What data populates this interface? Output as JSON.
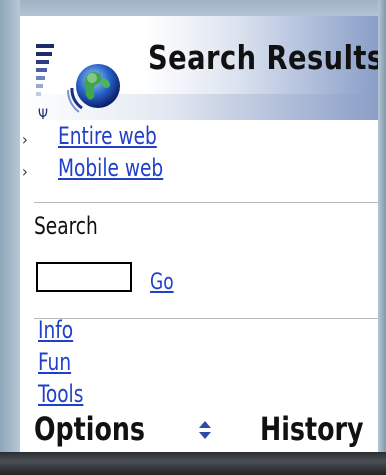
{
  "header": {
    "title": "Search Results",
    "icon": "globe-icon"
  },
  "search_scope": {
    "items": [
      {
        "label": "Entire web"
      },
      {
        "label": "Mobile web"
      }
    ]
  },
  "search": {
    "label": "Search",
    "input_value": "",
    "go_label": "Go"
  },
  "categories": {
    "items": [
      {
        "label": "Info"
      },
      {
        "label": "Fun"
      },
      {
        "label": "Tools"
      }
    ]
  },
  "softkeys": {
    "left": "Options",
    "right": "History"
  },
  "colors": {
    "link": "#2140c8",
    "title_gradient_end": "#8a9ec8",
    "scroll_indicator": "#2c4aa8"
  }
}
